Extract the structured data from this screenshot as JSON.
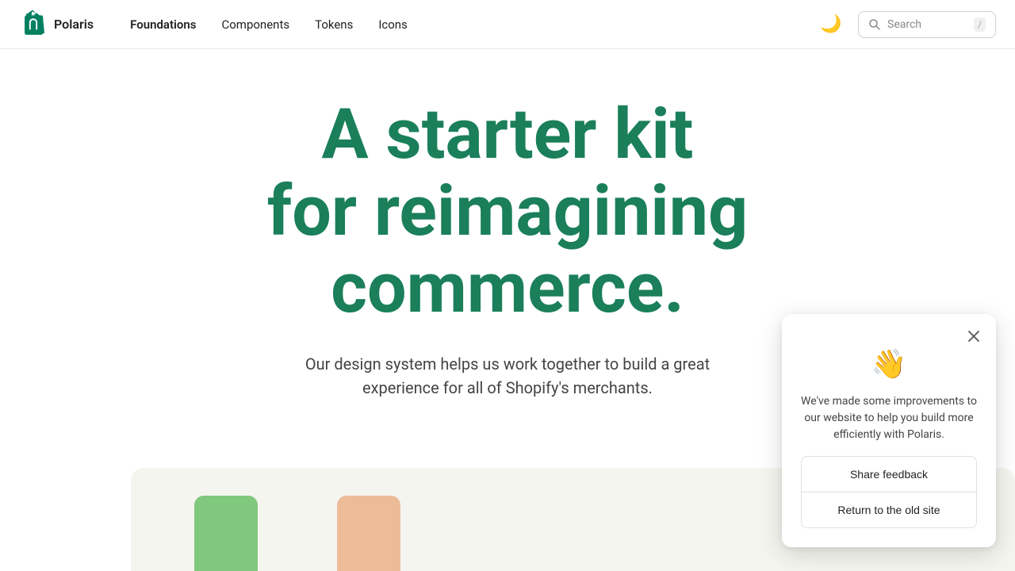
{
  "navbar": {
    "brand": "Polaris",
    "nav_items": [
      {
        "label": "Foundations",
        "active": true
      },
      {
        "label": "Components",
        "active": false
      },
      {
        "label": "Tokens",
        "active": false
      },
      {
        "label": "Icons",
        "active": false
      }
    ],
    "theme_icon": "🌙",
    "search": {
      "label": "Search",
      "shortcut": "/"
    }
  },
  "hero": {
    "title_line1": "A starter kit",
    "title_line2": "for reimagining",
    "title_line3": "commerce.",
    "subtitle": "Our design system helps us work together to build a great experience for all of Shopify's merchants."
  },
  "popup": {
    "emoji": "👋",
    "message": "We've made some improvements to our website to help you build more efficiently with Polaris.",
    "share_feedback_label": "Share feedback",
    "return_old_site_label": "Return to the old site"
  }
}
